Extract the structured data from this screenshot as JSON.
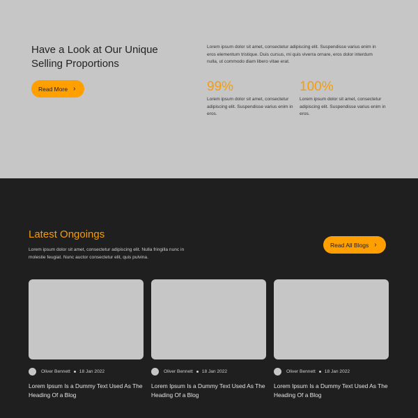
{
  "hero": {
    "title": "Have a Look at Our Unique\nSelling Proportions",
    "button_label": "Read More",
    "button_icon": "chevron-right-icon",
    "paragraph": "Lorem ipsum dolor sit amet, consectetur adipiscing elit. Suspendisse varius enim in eros elementum tristique. Duis cursus, mi quis viverra ornare, eros dolor interdum nulla, ut commodo diam libero vitae erat.",
    "stats": [
      {
        "value": "99%",
        "text": "Lorem ipsum dolor sit amet, consectetur adipiscing elit. Suspendisse varius enim in eros."
      },
      {
        "value": "100%",
        "text": "Lorem ipsum dolor sit amet, consectetur adipiscing elit. Suspendisse varius enim in eros."
      }
    ]
  },
  "blog": {
    "heading": "Latest Ongoings",
    "subtext": "Lorem ipsum dolor sit amet, consectetur adipiscing elit. Nulla fringilla nunc in molestie feugiat. Nunc auctor consectetur elit, quis pulvina.",
    "button_label": "Read All Blogs",
    "cards": [
      {
        "author": "Oliver Bennett",
        "date": "18 Jan 2022",
        "title": "Lorem Ipsum Is a Dummy Text Used As The\nHeading Of a Blog"
      },
      {
        "author": "Oliver Bennett",
        "date": "18 Jan 2022",
        "title": "Lorem Ipsum Is a Dummy Text Used As The\nHeading Of a Blog"
      },
      {
        "author": "Oliver Bennett",
        "date": "18 Jan 2022",
        "title": "Lorem Ipsum Is a Dummy Text Used As The\nHeading Of a Blog"
      }
    ]
  },
  "colors": {
    "accent": "#ff9f00",
    "top_bg": "#c6c6c6",
    "bottom_bg": "#1f1f1f"
  }
}
